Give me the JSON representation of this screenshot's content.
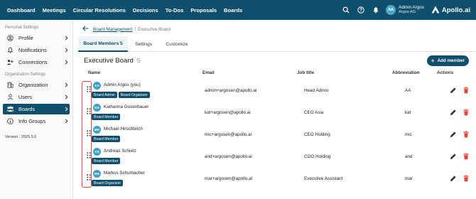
{
  "topbar": {
    "nav": [
      "Dashboard",
      "Meetings",
      "Circular Resolutions",
      "Decisions",
      "To-Dos",
      "Proposals",
      "Boards"
    ],
    "user": {
      "initials": "AA",
      "name": "Admin Argos",
      "org": "Argos AG"
    },
    "brand": "Apollo.ai"
  },
  "sidebar": {
    "personal_header": "Personal Settings",
    "personal_items": [
      {
        "label": "Profile",
        "icon": "profile-icon"
      },
      {
        "label": "Notifications",
        "icon": "bell-icon"
      },
      {
        "label": "Connections",
        "icon": "connections-icon"
      }
    ],
    "org_header": "Organization Settings",
    "org_items": [
      {
        "label": "Organization",
        "icon": "building-icon"
      },
      {
        "label": "Users",
        "icon": "user-icon"
      },
      {
        "label": "Boards",
        "icon": "people-icon",
        "active": true
      },
      {
        "label": "Info Groups",
        "icon": "info-icon"
      }
    ],
    "version": "Version : 2025.5.0"
  },
  "breadcrumb": {
    "link": "Board Management",
    "separator": "/",
    "current": "Executive Board"
  },
  "tabs": [
    {
      "label": "Board Members 5",
      "active": true
    },
    {
      "label": "Settings",
      "active": false
    },
    {
      "label": "Customize",
      "active": false
    }
  ],
  "section": {
    "title": "Executive Board",
    "count": "5",
    "add_label": "Add member",
    "add_icon": "+"
  },
  "table": {
    "columns": [
      "Name",
      "Email",
      "Job title",
      "Abbreviation",
      "Actions"
    ],
    "rows": [
      {
        "initials": "AA",
        "name": "Admin Argos (you)",
        "badges": [
          "Board Admin",
          "Board Organizer"
        ],
        "email": "admin+argosen@apollo.ai",
        "job": "Head Admin",
        "abbr": "AA"
      },
      {
        "initials": "KG",
        "name": "Katharina Gusenbauer",
        "badges": [
          "Board Member"
        ],
        "email": "kat+argosen@apollo.ai",
        "job": "CEO Asia",
        "abbr": "kat"
      },
      {
        "initials": "MH",
        "name": "Michael Hirschbrich",
        "badges": [
          "Board Member"
        ],
        "email": "mic+argosen@apollo.ai",
        "job": "CEO Holding",
        "abbr": "mic"
      },
      {
        "initials": "AS",
        "name": "Andreas Schietz",
        "badges": [
          "Board Member"
        ],
        "email": "and+argosen@apollo.ai",
        "job": "COO Holding",
        "abbr": "and"
      },
      {
        "initials": "MS",
        "name": "Markus Schumacher",
        "badges": [
          "Board Organizer"
        ],
        "email": "mar+argosen@apollo.ai",
        "job": "Executive Assistant",
        "abbr": "mar"
      }
    ]
  },
  "colors": {
    "primary": "#0f4f6b",
    "avatar": "#41a0bf",
    "delete": "#e0473f",
    "edit": "#2f2f2f",
    "drag_highlight": "#e0473f"
  }
}
